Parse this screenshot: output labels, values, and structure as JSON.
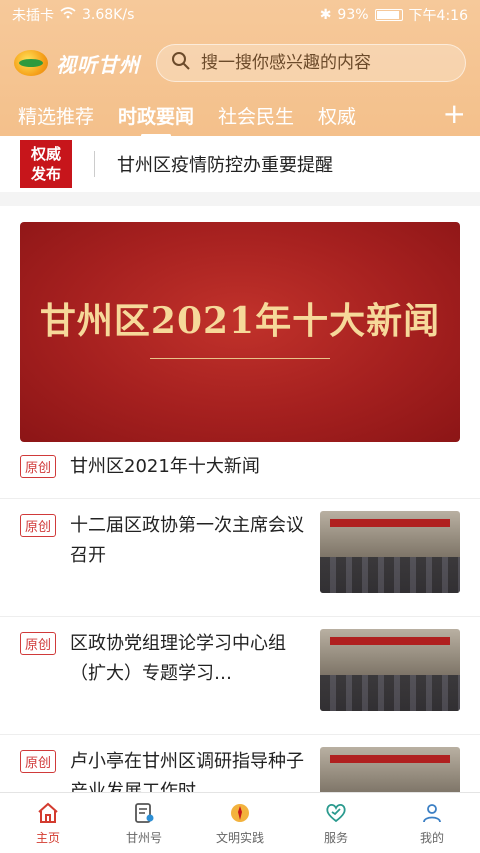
{
  "status_bar": {
    "carrier": "未插卡",
    "speed": "3.68K/s",
    "battery": "93%",
    "time": "下午4:16"
  },
  "app": {
    "logo_text": "视听甘州"
  },
  "search": {
    "placeholder": "搜一搜你感兴趣的内容"
  },
  "tabs": [
    {
      "label": "精选推荐",
      "active": false
    },
    {
      "label": "时政要闻",
      "active": true
    },
    {
      "label": "社会民生",
      "active": false
    },
    {
      "label": "权威",
      "active": false
    }
  ],
  "plus_label": "+",
  "notice": {
    "badge_line1": "权威",
    "badge_line2": "发布",
    "text": "甘州区疫情防控办重要提醒"
  },
  "banner": {
    "title": "甘州区2021年十大新闻"
  },
  "first_item": {
    "tag": "原创",
    "title": "甘州区2021年十大新闻"
  },
  "news": [
    {
      "tag": "原创",
      "title": "十二届区政协第一次主席会议召开"
    },
    {
      "tag": "原创",
      "title": "区政协党组理论学习中心组（扩大）专题学习…"
    },
    {
      "tag": "原创",
      "title": "卢小亭在甘州区调研指导种子产业发展工作时…"
    }
  ],
  "bottom_nav": [
    {
      "label": "主页",
      "icon": "home-icon",
      "active": true
    },
    {
      "label": "甘州号",
      "icon": "account-icon",
      "active": false
    },
    {
      "label": "文明实践",
      "icon": "civilization-icon",
      "active": false
    },
    {
      "label": "服务",
      "icon": "service-icon",
      "active": false
    },
    {
      "label": "我的",
      "icon": "user-icon",
      "active": false
    }
  ],
  "colors": {
    "header": "#f4c08b",
    "accent_red": "#c7151b",
    "nav_active": "#d33b2f"
  }
}
